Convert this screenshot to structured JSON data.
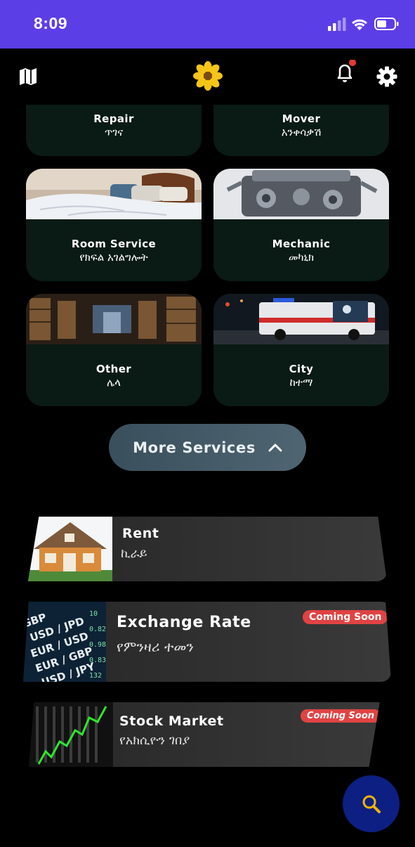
{
  "status_bar": {
    "time": "8:09",
    "color": "#5b3ee6"
  },
  "header": {
    "icons": [
      "map-icon",
      "sunflower-logo",
      "bell-icon",
      "gear-icon"
    ],
    "notification_dot_color": "#e53935"
  },
  "services": [
    {
      "name": "Repair",
      "amharic": "ጥገና"
    },
    {
      "name": "Mover",
      "amharic": "አንቀሳቃሽ"
    },
    {
      "name": "Room Service",
      "amharic": "የክፍል አገልግሎት"
    },
    {
      "name": "Mechanic",
      "amharic": "መካኒክ"
    },
    {
      "name": "Other",
      "amharic": "ሌላ"
    },
    {
      "name": "City",
      "amharic": "ከተማ"
    }
  ],
  "more_services": {
    "label": "More Services",
    "icon": "chevron-up-icon"
  },
  "featured": [
    {
      "title": "Rent",
      "amharic": "ኪራይ",
      "badge": ""
    },
    {
      "title": "Exchange Rate",
      "amharic": "የምንዛሪ ተመን",
      "badge": "Coming Soon"
    },
    {
      "title": "Stock Market",
      "amharic": "የአክሲዮን ገበያ",
      "badge": "Coming Soon"
    }
  ],
  "fab": {
    "icon": "search-icon",
    "color": "#0d1f82"
  }
}
